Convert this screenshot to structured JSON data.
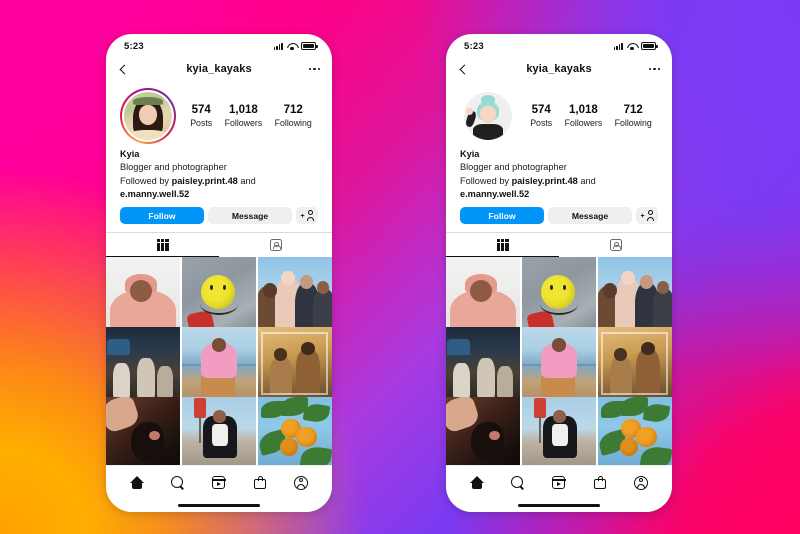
{
  "background": {
    "colors": {
      "top_left": "#FF009E",
      "top_right": "#7B3BF5",
      "bottom_left": "#FFA100",
      "bottom_right": "#FF0061"
    }
  },
  "theme": {
    "accent_blue": "#0095F6",
    "button_grey": "#EFEFEF",
    "text_dark": "#111111",
    "divider": "#DBDBDB"
  },
  "phones": [
    {
      "id": "phone-left",
      "avatar_type": "photo",
      "has_story_ring": true,
      "status_bar": {
        "time": "5:23"
      },
      "nav": {
        "title": "kyia_kayaks",
        "back_icon": "chevron-left-icon",
        "more_icon": "more-options-icon"
      },
      "stats": [
        {
          "number": "574",
          "label": "Posts"
        },
        {
          "number": "1,018",
          "label": "Followers"
        },
        {
          "number": "712",
          "label": "Following"
        }
      ],
      "bio": {
        "name": "Kyia",
        "description": "Blogger and photographer",
        "followed_by_prefix": "Followed by ",
        "followed_by_user1": "paisley.print.48",
        "followed_by_join": " and ",
        "followed_by_user2": "e.manny.well.52"
      },
      "actions": {
        "follow_label": "Follow",
        "message_label": "Message",
        "add_user_icon": "add-person-icon"
      },
      "tabs": [
        {
          "icon": "grid-icon",
          "active": true
        },
        {
          "icon": "tagged-photos-icon",
          "active": false
        }
      ],
      "bottom_nav": [
        {
          "icon": "home-icon"
        },
        {
          "icon": "search-icon"
        },
        {
          "icon": "reels-icon"
        },
        {
          "icon": "shop-icon"
        },
        {
          "icon": "profile-icon"
        }
      ]
    },
    {
      "id": "phone-right",
      "avatar_type": "cartoon-avatar",
      "has_story_ring": false,
      "status_bar": {
        "time": "5:23"
      },
      "nav": {
        "title": "kyia_kayaks",
        "back_icon": "chevron-left-icon",
        "more_icon": "more-options-icon"
      },
      "stats": [
        {
          "number": "574",
          "label": "Posts"
        },
        {
          "number": "1,018",
          "label": "Followers"
        },
        {
          "number": "712",
          "label": "Following"
        }
      ],
      "bio": {
        "name": "Kyia",
        "description": "Blogger and photographer",
        "followed_by_prefix": "Followed by ",
        "followed_by_user1": "paisley.print.48",
        "followed_by_join": " and ",
        "followed_by_user2": "e.manny.well.52"
      },
      "actions": {
        "follow_label": "Follow",
        "message_label": "Message",
        "add_user_icon": "add-person-icon"
      },
      "tabs": [
        {
          "icon": "grid-icon",
          "active": true
        },
        {
          "icon": "tagged-photos-icon",
          "active": false
        }
      ],
      "bottom_nav": [
        {
          "icon": "home-icon"
        },
        {
          "icon": "search-icon"
        },
        {
          "icon": "reels-icon"
        },
        {
          "icon": "shop-icon"
        },
        {
          "icon": "profile-icon"
        }
      ]
    }
  ],
  "photo_grid": [
    {
      "position": 1,
      "description": "person in pink hoodie on white background"
    },
    {
      "position": 2,
      "description": "yellow smiley face balloon on grey pavement"
    },
    {
      "position": 3,
      "description": "group of friends posing outdoors"
    },
    {
      "position": 4,
      "description": "night street scene with people and car"
    },
    {
      "position": 5,
      "description": "person in pink hoodie crouching by the water"
    },
    {
      "position": 6,
      "description": "warm toned interior portrait of two people"
    },
    {
      "position": 7,
      "description": "dark close-up photo with a hand"
    },
    {
      "position": 8,
      "description": "person in black jacket standing outdoors"
    },
    {
      "position": 9,
      "description": "oranges growing on a tree against blue sky"
    }
  ]
}
